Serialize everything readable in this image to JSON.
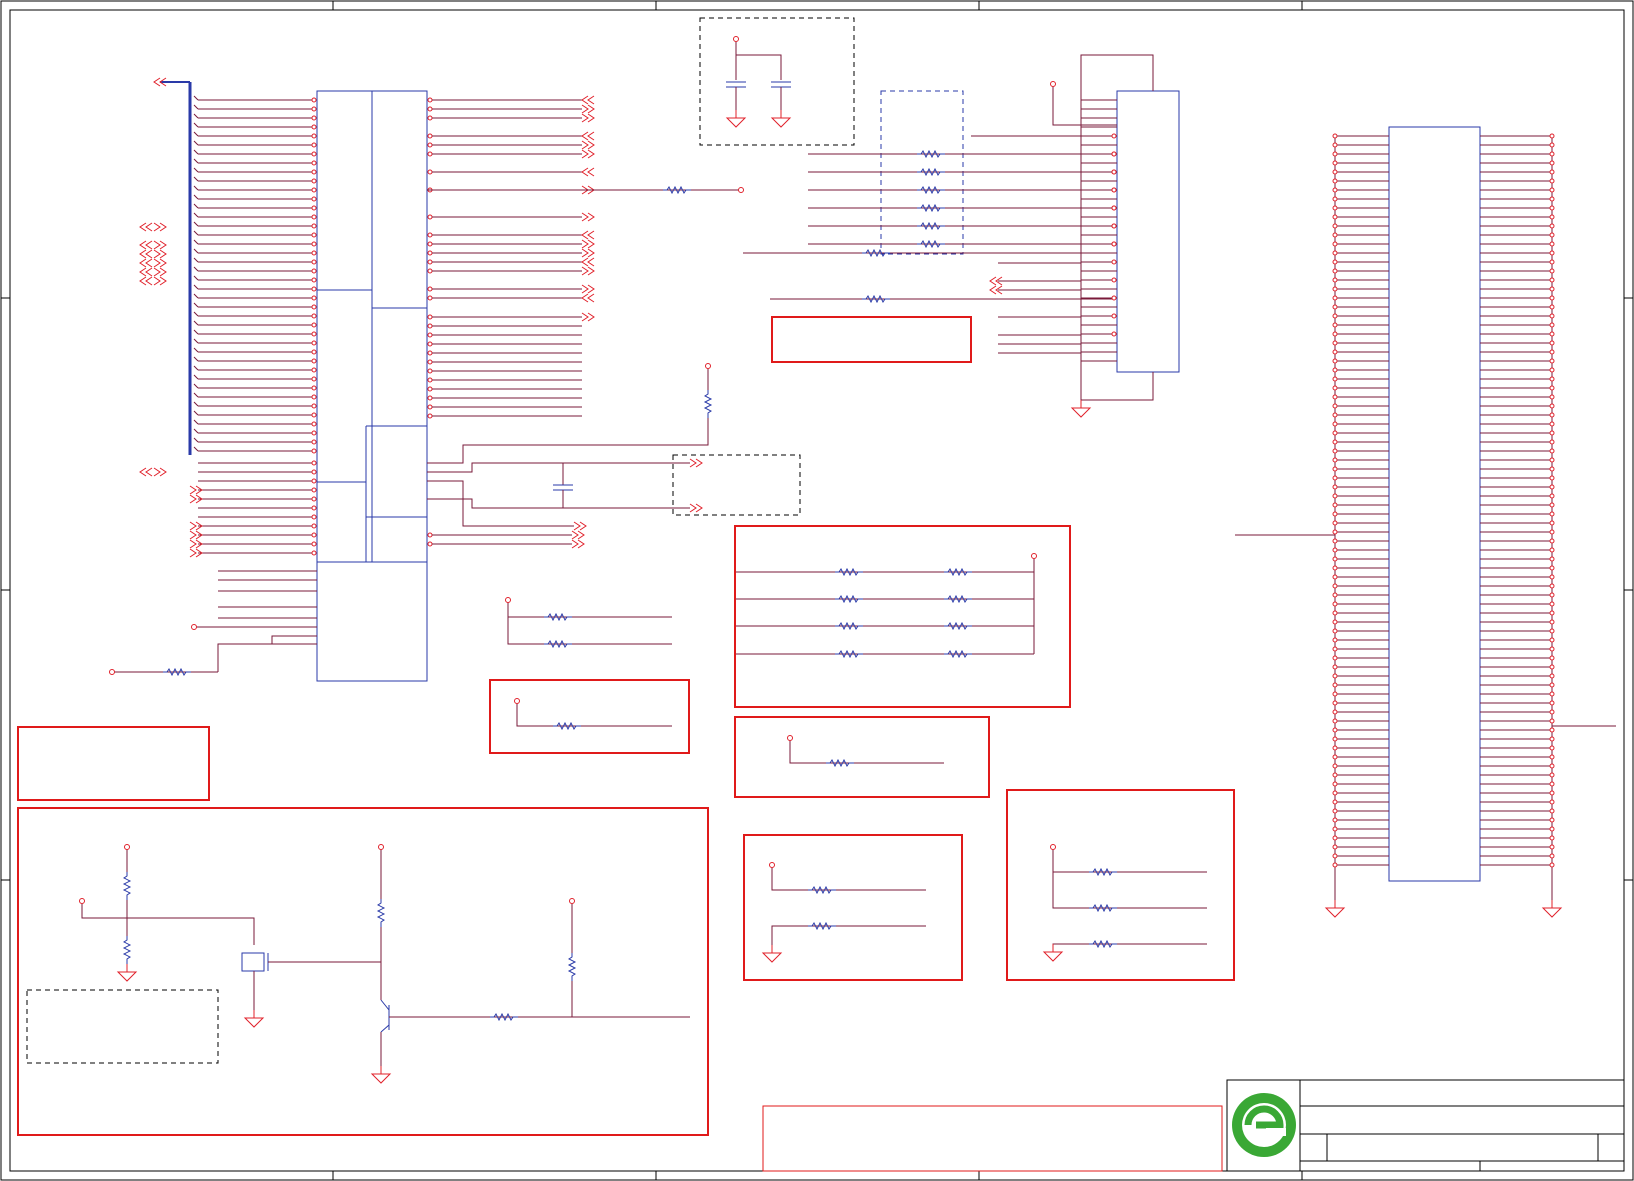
{
  "sheet": {
    "title": "",
    "frame_color": "#000000",
    "wire_color": "#7a1a3a",
    "pin_color": "#e0202a",
    "component_color": "#2a3aa8",
    "note_box_color": "#e01a1a",
    "logo_color": "#3aa835"
  },
  "chips": [
    {
      "name": "soc-main-ic",
      "label": ""
    },
    {
      "name": "connector-a",
      "label": ""
    },
    {
      "name": "connector-b-long",
      "label": ""
    }
  ],
  "note_boxes": [
    {
      "name": "note-box-display",
      "text": ""
    },
    {
      "name": "note-box-left",
      "text": ""
    },
    {
      "name": "note-box-power-circuit",
      "text": ""
    },
    {
      "name": "note-box-bottom",
      "text": ""
    }
  ],
  "title_block": {
    "company": "",
    "title": "",
    "doc_number": "",
    "rev": "",
    "sheet": ""
  },
  "icons": [
    "logo-icon",
    "resistor-icon",
    "capacitor-icon",
    "ground-icon",
    "transistor-icon",
    "mosfet-icon",
    "offpage-arrow-icon",
    "power-pin-icon"
  ]
}
